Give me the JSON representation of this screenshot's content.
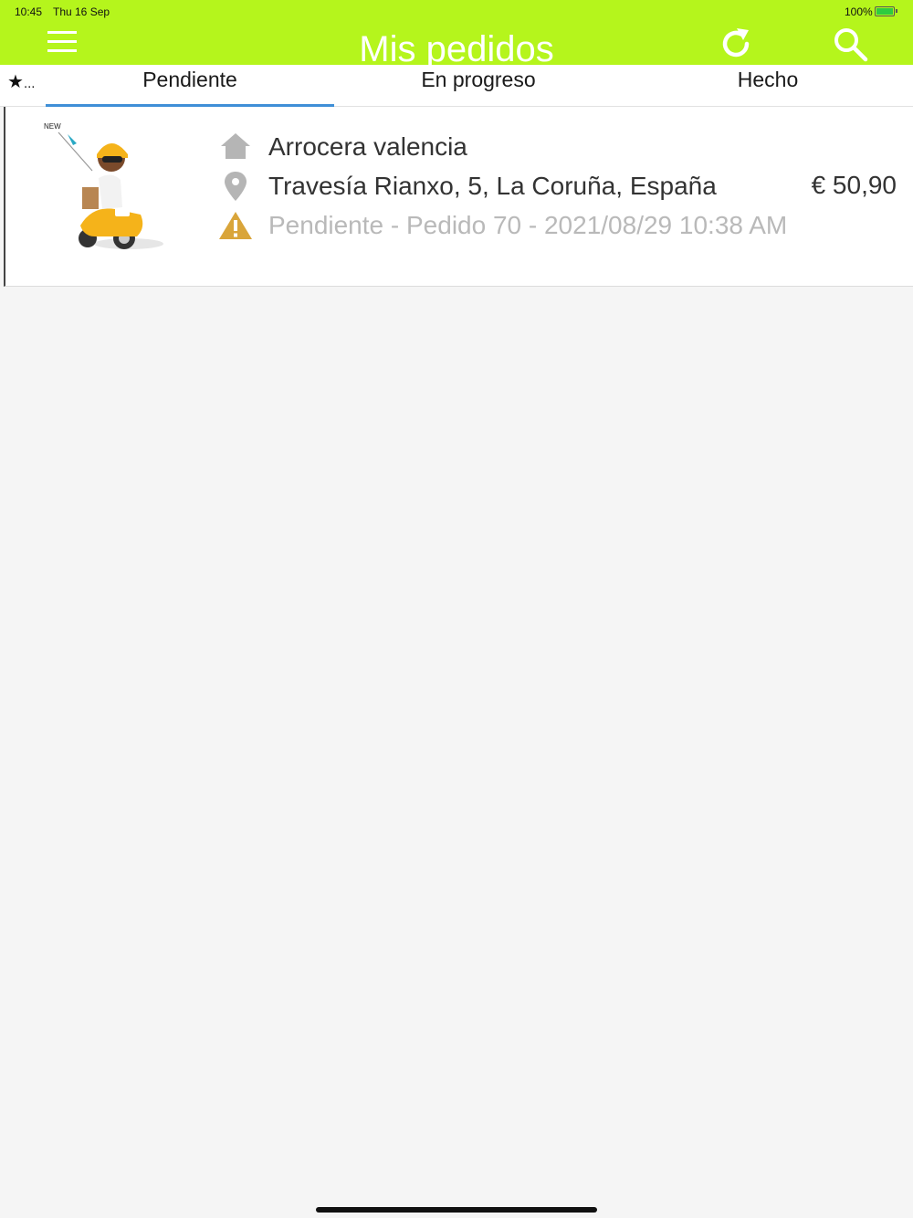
{
  "status_bar": {
    "time": "10:45",
    "date": "Thu 16 Sep",
    "battery": "100%"
  },
  "header": {
    "title": "Mis pedidos",
    "background_color": "#b5f51c",
    "icons": [
      "menu-icon",
      "refresh-icon",
      "search-icon"
    ]
  },
  "tabs": {
    "star_label": "★",
    "star_more": "...",
    "items": [
      {
        "label": "Pendiente",
        "selected": true
      },
      {
        "label": "En progreso",
        "selected": false
      },
      {
        "label": "Hecho",
        "selected": false
      }
    ],
    "indicator_color": "#3f8fd7"
  },
  "orders": [
    {
      "badge": "NEW",
      "restaurant": "Arrocera valencia",
      "address": "Travesía Rianxo, 5, La Coruña, España",
      "price": "€ 50,90",
      "status_line": "Pendiente - Pedido 70 - 2021/08/29 10:38 AM",
      "icons": [
        "home-icon",
        "location-pin-icon",
        "warning-icon"
      ],
      "warning_color": "#d9a53a"
    }
  ]
}
